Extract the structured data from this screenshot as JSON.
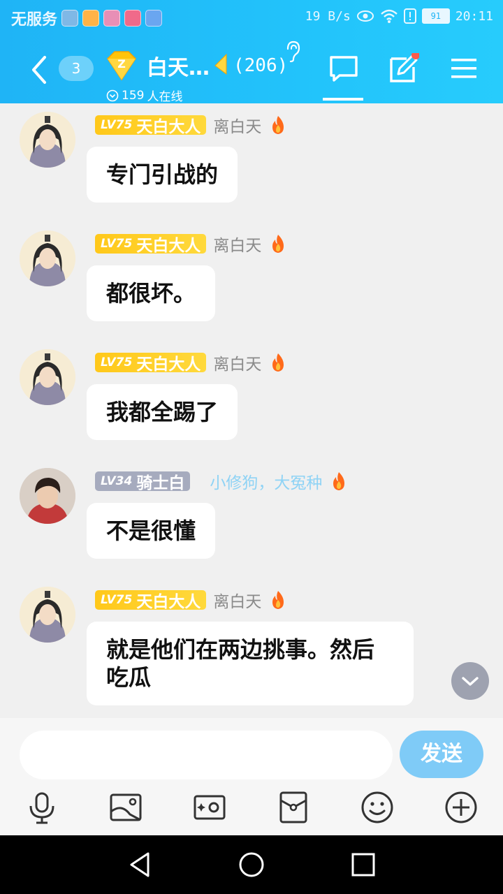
{
  "status_bar": {
    "carrier": "无服务",
    "speed": "19 B/s",
    "battery": "91",
    "time": "20:11",
    "app_icon_colors": [
      "#7fb8e6",
      "#ffb347",
      "#e88fb6",
      "#f06a8a",
      "#6aa6f0"
    ]
  },
  "header": {
    "unread_count": "3",
    "group_title": "白天…",
    "member_count": "(206)",
    "online_count": "159",
    "online_label": "人在线"
  },
  "messages": [
    {
      "level": "LV75",
      "title": "天白大人",
      "nick": "离白天",
      "text": "专门引战的",
      "avatar": "female-avatar"
    },
    {
      "level": "LV75",
      "title": "天白大人",
      "nick": "离白天",
      "text": "都很坏。",
      "avatar": "female-avatar"
    },
    {
      "level": "LV75",
      "title": "天白大人",
      "nick": "离白天",
      "text": "我都全踢了",
      "avatar": "female-avatar"
    },
    {
      "level": "LV34",
      "title": "骑士白",
      "nick": "小修狗，大冤种",
      "text": "不是很懂",
      "avatar": "male-avatar"
    },
    {
      "level": "LV75",
      "title": "天白大人",
      "nick": "离白天",
      "text": "就是他们在两边挑事。然后吃瓜",
      "avatar": "female-avatar"
    }
  ],
  "composer": {
    "placeholder": "",
    "send_label": "发送"
  },
  "colors": {
    "header": "#1fb4f6",
    "gold_badge": "#ffc81a",
    "gray_badge": "#a6abbe",
    "send": "#7fcbf7"
  }
}
